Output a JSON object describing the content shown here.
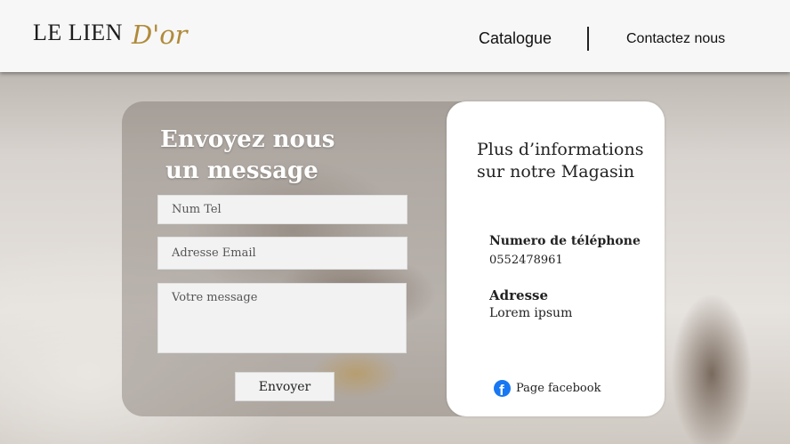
{
  "header": {
    "logo_main": "LE LIEN",
    "logo_script": "D'or",
    "nav": {
      "catalogue": "Catalogue",
      "contact": "Contactez nous"
    }
  },
  "form": {
    "title_line1": "Envoyez nous",
    "title_line2": "un message",
    "tel_placeholder": "Num Tel",
    "email_placeholder": "Adresse Email",
    "message_placeholder": "Votre message",
    "submit_label": "Envoyer"
  },
  "info": {
    "title_line1": "Plus d’informations",
    "title_line2": "sur notre Magasin",
    "phone_label": "Numero de téléphone",
    "phone_value": "0552478961",
    "address_label": "Adresse",
    "address_value": "Lorem ipsum",
    "facebook_label": "Page facebook",
    "facebook_icon": "facebook-icon"
  },
  "colors": {
    "logo_gold": "#b08a3a",
    "facebook_blue": "#1877f2"
  }
}
